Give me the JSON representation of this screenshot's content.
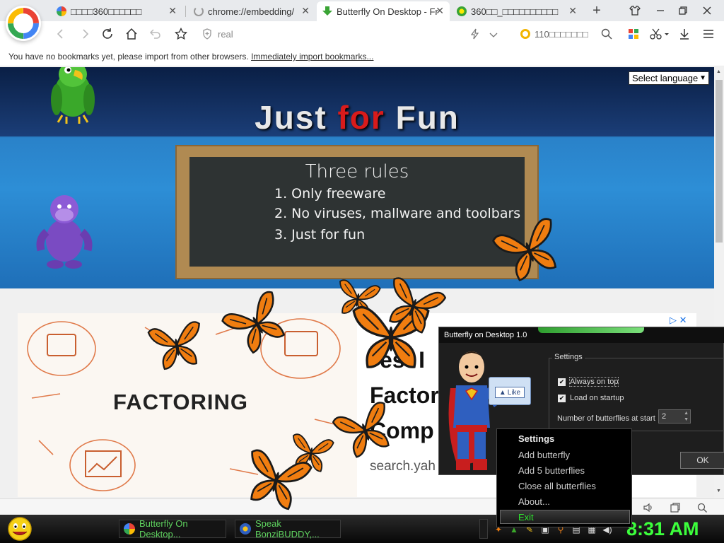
{
  "browser": {
    "tabs": [
      {
        "title": "□□□□360□□□□□□",
        "favicon_color": "#f4b400",
        "active": false
      },
      {
        "title": "chrome://embedding/",
        "favicon_color": "#999999",
        "active": false
      },
      {
        "title": "Butterfly On Desktop - Fr",
        "favicon_color": "#3aa435",
        "active": true
      },
      {
        "title": "360□□_□□□□□□□□□□",
        "favicon_color": "#9acd32",
        "active": false
      }
    ],
    "close_glyph": "✕",
    "new_tab_glyph": "+",
    "address_value": "real",
    "search_placeholder": "110□□□□□□□",
    "bookmarks_bar_text": "You have no bookmarks yet, please import from other browsers.",
    "bookmarks_bar_link": "Immediately import bookmarks..."
  },
  "site": {
    "language_select": "Select language",
    "headline_part1": "Just ",
    "headline_part2": "for",
    "headline_part3": " Fun",
    "rules_title": "Three rules",
    "rules": [
      "1. Only freeware",
      "2. No viruses, mallware and toolbars",
      "3. Just for fun"
    ]
  },
  "ad": {
    "image_text": "FACTORING",
    "headline_line1": "est I",
    "headline_line2": "Factor",
    "headline_line3": "Comp",
    "url": "search.yah"
  },
  "butterfly_app": {
    "window_title": "Butterfly on Desktop 1.0",
    "settings_label": "Settings",
    "always_on_top_label": "Always on top",
    "always_on_top_checked": true,
    "load_on_startup_label": "Load on startup",
    "load_on_startup_checked": true,
    "num_butterflies_label": "Number of butterflies at start",
    "num_butterflies_value": "2",
    "ok_label": "OK",
    "like_label": "Like"
  },
  "context_menu": {
    "items": [
      "Settings",
      "Add butterfly",
      "Add 5 butterflies",
      "Close all butterflies",
      "About...",
      "Exit"
    ],
    "selected": "Exit"
  },
  "taskbar": {
    "buttons": [
      "Butterfly On Desktop...",
      "Speak BonziBUDDY,..."
    ],
    "clock": "8:31 AM"
  },
  "colors": {
    "accent_green": "#3cff3c",
    "banner_blue": "#2a82c9",
    "chalkboard": "#2e3333",
    "butterfly_orange": "#f07d10"
  }
}
